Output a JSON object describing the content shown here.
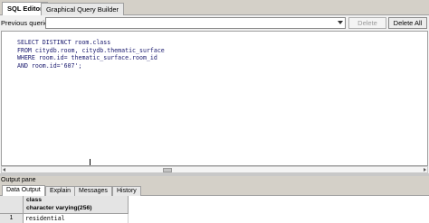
{
  "tabs": [
    {
      "label": "SQL Editor",
      "active": true
    },
    {
      "label": "Graphical Query Builder",
      "active": false
    }
  ],
  "previous_queries": {
    "label": "Previous queries",
    "value": ""
  },
  "buttons": {
    "delete": {
      "label": "Delete",
      "enabled": false
    },
    "delete_all": {
      "label": "Delete All",
      "enabled": true
    }
  },
  "editor": {
    "lines": [
      "SELECT DISTINCT room.class",
      "FROM citydb.room, citydb.thematic_surface",
      "WHERE room.id= thematic_surface.room_id",
      "AND room.id='607';"
    ]
  },
  "output": {
    "title": "Output pane",
    "tabs": [
      {
        "label": "Data Output",
        "active": true
      },
      {
        "label": "Explain",
        "active": false
      },
      {
        "label": "Messages",
        "active": false
      },
      {
        "label": "History",
        "active": false
      }
    ],
    "columns": [
      {
        "name": "class",
        "type": "character varying(256)"
      }
    ],
    "rows": [
      {
        "num": "1",
        "values": [
          "residential"
        ]
      }
    ]
  },
  "icons": {
    "dropdown": "chevron-down-icon",
    "scroll_left": "arrow-left-icon",
    "scroll_right": "arrow-right-icon"
  }
}
